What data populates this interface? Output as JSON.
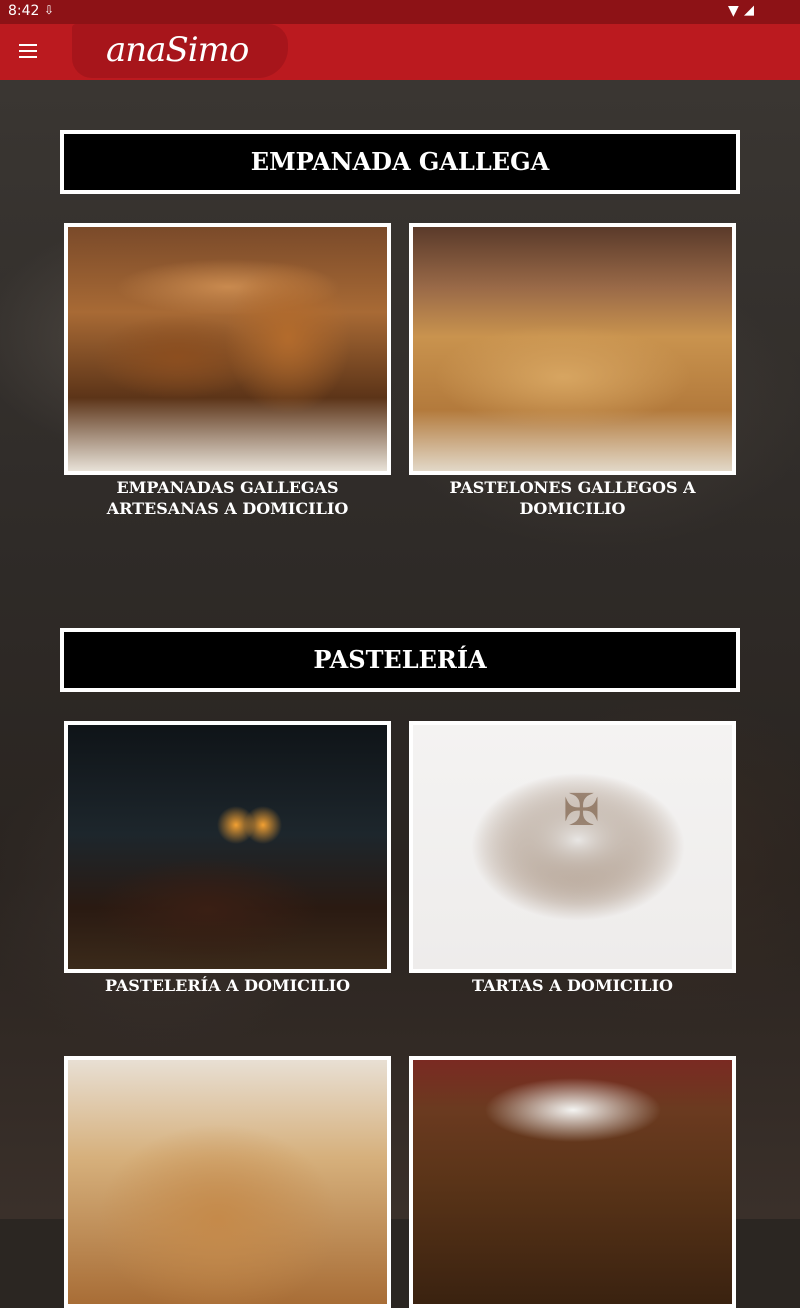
{
  "status_bar": {
    "time": "8:42",
    "download_icon": "download-icon",
    "wifi_icon": "wifi-icon",
    "signal_icon": "signal-icon"
  },
  "app_bar": {
    "menu_icon": "hamburger-menu-icon",
    "logo_text": "anaSimo",
    "colors": {
      "status": "#8d1216",
      "bar": "#bb1a1f",
      "logo_bg": "#a7151b"
    }
  },
  "sections": [
    {
      "title": "EMPANADA GALLEGA",
      "items": [
        {
          "caption": "EMPANADAS GALLEGAS ARTESANAS A DOMICILIO"
        },
        {
          "caption": "PASTELONES GALLEGOS A DOMICILIO"
        }
      ]
    },
    {
      "title": "PASTELERÍA",
      "items": [
        {
          "caption": "PASTELERÍA A DOMICILIO"
        },
        {
          "caption": "TARTAS A DOMICILIO"
        },
        {
          "caption": ""
        },
        {
          "caption": ""
        }
      ]
    }
  ]
}
